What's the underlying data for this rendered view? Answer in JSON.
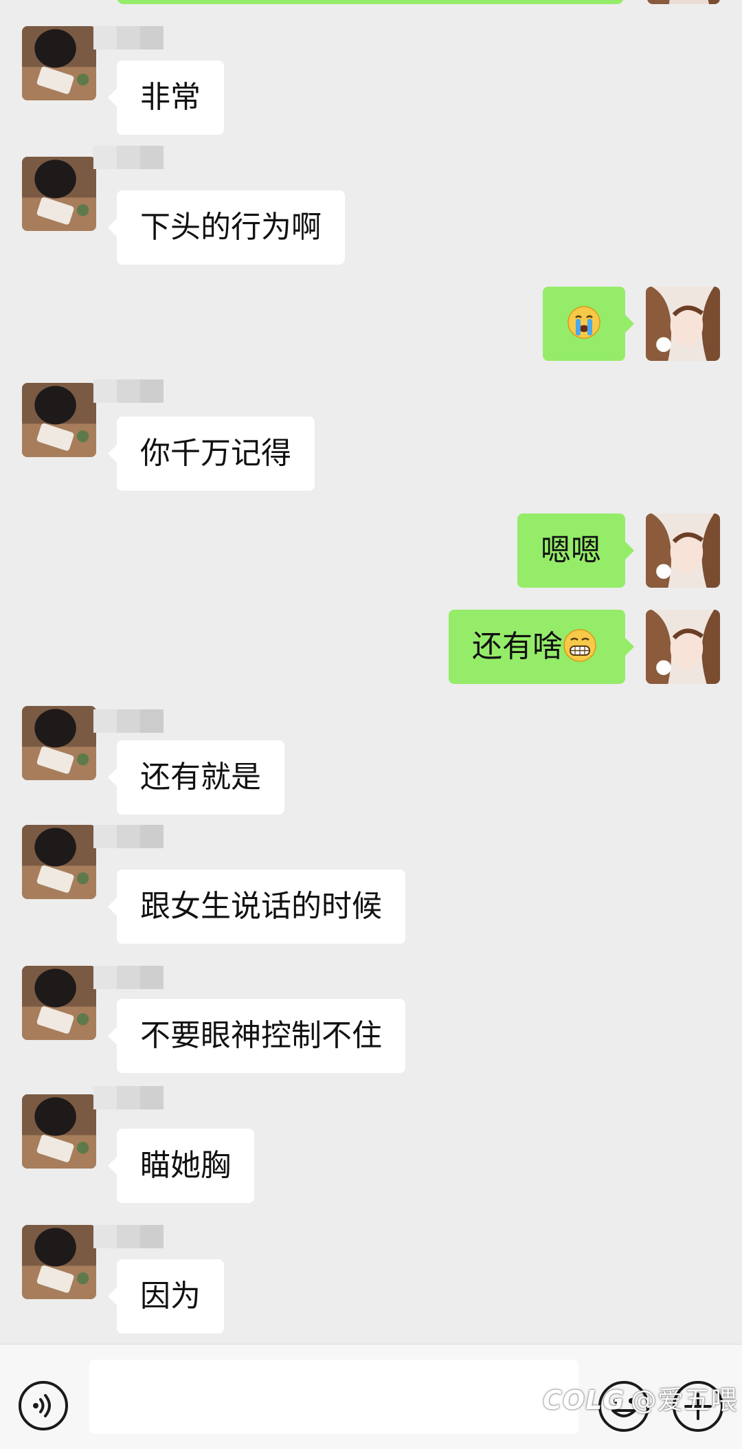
{
  "chat": {
    "messages": [
      {
        "side": "in",
        "text": "非常"
      },
      {
        "side": "in",
        "text": "下头的行为啊"
      },
      {
        "side": "out",
        "text": "",
        "emoji": "crying-face-emoji"
      },
      {
        "side": "in",
        "text": "你千万记得"
      },
      {
        "side": "out",
        "text": "嗯嗯"
      },
      {
        "side": "out",
        "text": "还有啥",
        "emoji": "grimacing-face-emoji"
      },
      {
        "side": "in",
        "text": "还有就是"
      },
      {
        "side": "in",
        "text": "跟女生说话的时候"
      },
      {
        "side": "in",
        "text": "不要眼神控制不住"
      },
      {
        "side": "in",
        "text": "瞄她胸"
      },
      {
        "side": "in",
        "text": "因为"
      }
    ]
  },
  "input_bar": {
    "placeholder": "",
    "voice_icon": "voice-icon",
    "emoji_icon": "emoji-icon",
    "plus_icon": "plus-icon"
  },
  "watermark": {
    "logo": "COLG",
    "text": "@爱五喂"
  },
  "colors": {
    "background": "#ededed",
    "incoming_bubble": "#ffffff",
    "outgoing_bubble": "#95ec69"
  }
}
